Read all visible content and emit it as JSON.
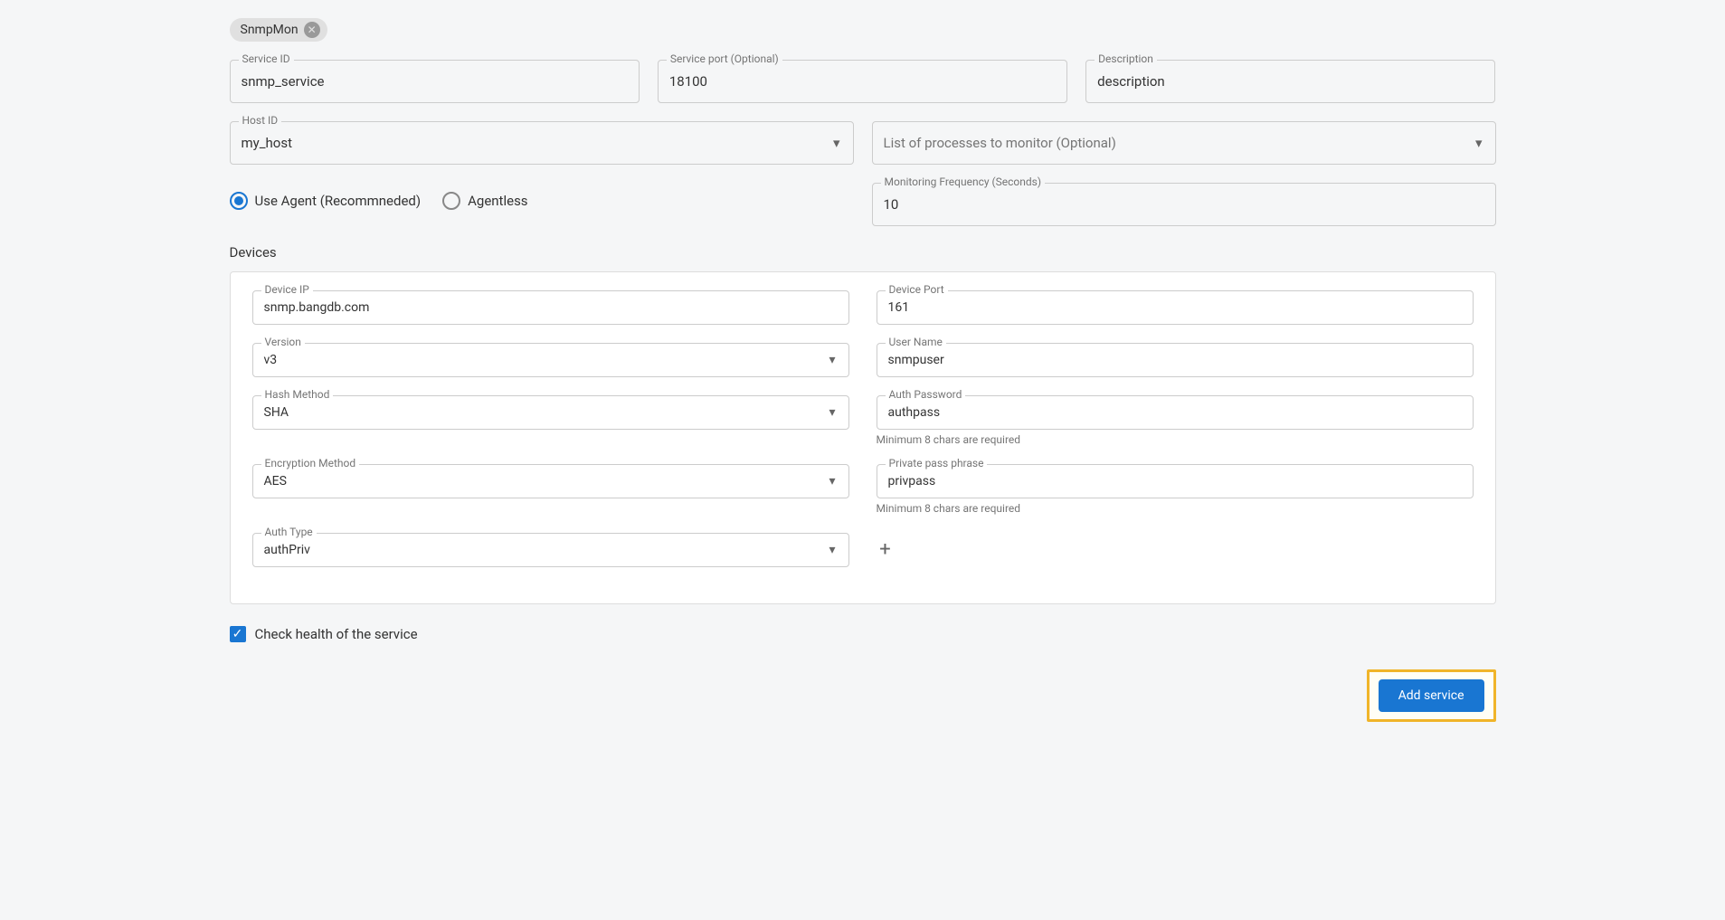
{
  "chip": {
    "label": "SnmpMon"
  },
  "fields": {
    "service_id": {
      "label": "Service ID",
      "value": "snmp_service"
    },
    "service_port": {
      "label": "Service port (Optional)",
      "value": "18100"
    },
    "description": {
      "label": "Description",
      "value": "description"
    },
    "host_id": {
      "label": "Host ID",
      "value": "my_host"
    },
    "process_list": {
      "placeholder": "List of processes to monitor (Optional)"
    },
    "monitoring_freq": {
      "label": "Monitoring Frequency (Seconds)",
      "value": "10"
    }
  },
  "radio": {
    "use_agent": "Use Agent (Recommneded)",
    "agentless": "Agentless"
  },
  "devices": {
    "section_label": "Devices",
    "device_ip": {
      "label": "Device IP",
      "value": "snmp.bangdb.com"
    },
    "device_port": {
      "label": "Device Port",
      "value": "161"
    },
    "version": {
      "label": "Version",
      "value": "v3"
    },
    "user_name": {
      "label": "User Name",
      "value": "snmpuser"
    },
    "hash_method": {
      "label": "Hash Method",
      "value": "SHA"
    },
    "auth_password": {
      "label": "Auth Password",
      "value": "authpass",
      "helper": "Minimum 8 chars are required"
    },
    "encryption_method": {
      "label": "Encryption Method",
      "value": "AES"
    },
    "private_pass": {
      "label": "Private pass phrase",
      "value": "privpass",
      "helper": "Minimum 8 chars are required"
    },
    "auth_type": {
      "label": "Auth Type",
      "value": "authPriv"
    }
  },
  "checkbox": {
    "label": "Check health of the service"
  },
  "button": {
    "add_service": "Add service"
  }
}
